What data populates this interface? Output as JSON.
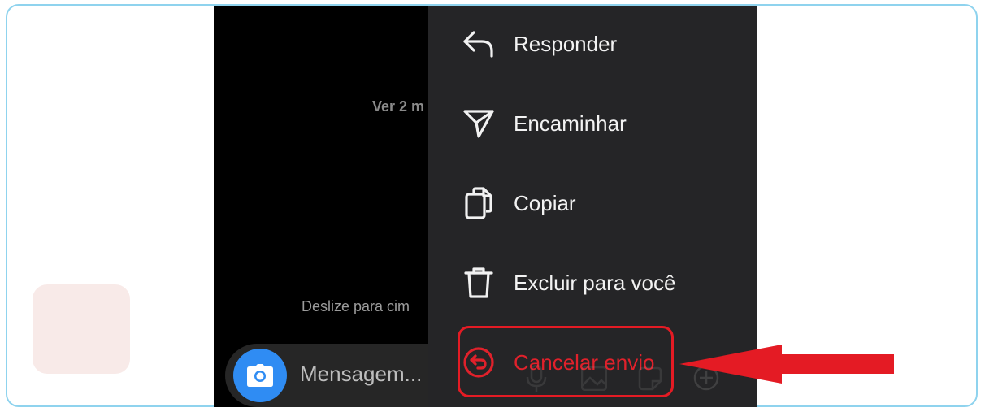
{
  "chat": {
    "preview_text": "Ver 2 m",
    "hint_text": "Deslize para cim"
  },
  "composer": {
    "placeholder": "Mensagem...",
    "camera_icon": "camera-icon"
  },
  "context_menu": {
    "items": [
      {
        "label": "Responder",
        "icon": "reply-icon"
      },
      {
        "label": "Encaminhar",
        "icon": "send-icon"
      },
      {
        "label": "Copiar",
        "icon": "copy-icon"
      },
      {
        "label": "Excluir para você",
        "icon": "trash-icon"
      },
      {
        "label": "Cancelar envio",
        "icon": "undo-icon"
      }
    ]
  },
  "colors": {
    "accent_blue": "#2f8cf3",
    "danger_red": "#e0212b",
    "menu_background": "#252527",
    "frame_border": "#8fd3ee"
  }
}
